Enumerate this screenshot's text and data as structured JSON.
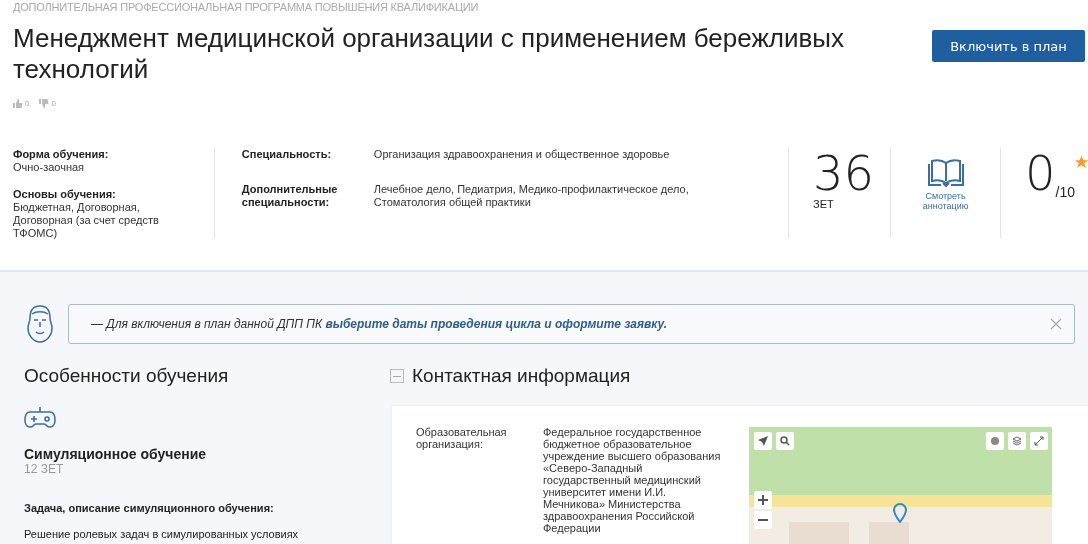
{
  "header": {
    "category": "ДОПОЛНИТЕЛЬНАЯ ПРОФЕССИОНАЛЬНАЯ ПРОГРАММА ПОВЫШЕНИЯ КВАЛИФИКАЦИИ",
    "title": "Менеджмент медицинской организации с применением бережливых технологий",
    "primary_button": "Включить в план",
    "likes": "0",
    "dislikes": "0"
  },
  "info": {
    "left": [
      {
        "label": "Форма обучения:",
        "value": "Очно-заочная"
      },
      {
        "label": "Основы обучения:",
        "value": "Бюджетная, Договорная, Договорная (за счет средств ТФОМС)"
      }
    ],
    "middle": [
      {
        "label": "Специальность:",
        "value": "Организация здравоохранения и общественное здоровье"
      },
      {
        "label": "Дополнительные специальности:",
        "value": "Лечебное дело, Педиатрия, Медико-профилактическое дело, Стоматология общей практики"
      }
    ],
    "credits": {
      "value": "36",
      "unit": "ЗЕТ"
    },
    "annotation_link": "Смотреть аннотацию",
    "rating": {
      "value": "0",
      "max": "/10"
    }
  },
  "notice": {
    "text": "— Для включения в план данной ДПП ПК ",
    "link": "выберите даты проведения цикла и оформите заявку."
  },
  "features": {
    "heading": "Особенности обучения",
    "title": "Симуляционное обучение",
    "credits": "12 ЗЕТ",
    "task_label": "Задача, описание симуляционного обучения:",
    "task_text": "Решение ролевых задач в симулированных условиях"
  },
  "contacts": {
    "heading": "Контактная информация",
    "expanded": true,
    "rows": [
      {
        "label": "Образовательная организация:",
        "value": "Федеральное государственное бюджетное образовательное учреждение высшего образования «Северо-Западный государственный медицинский университет имени И.И. Мечникова» Министерства здравоохранения Российской Федерации"
      }
    ]
  }
}
